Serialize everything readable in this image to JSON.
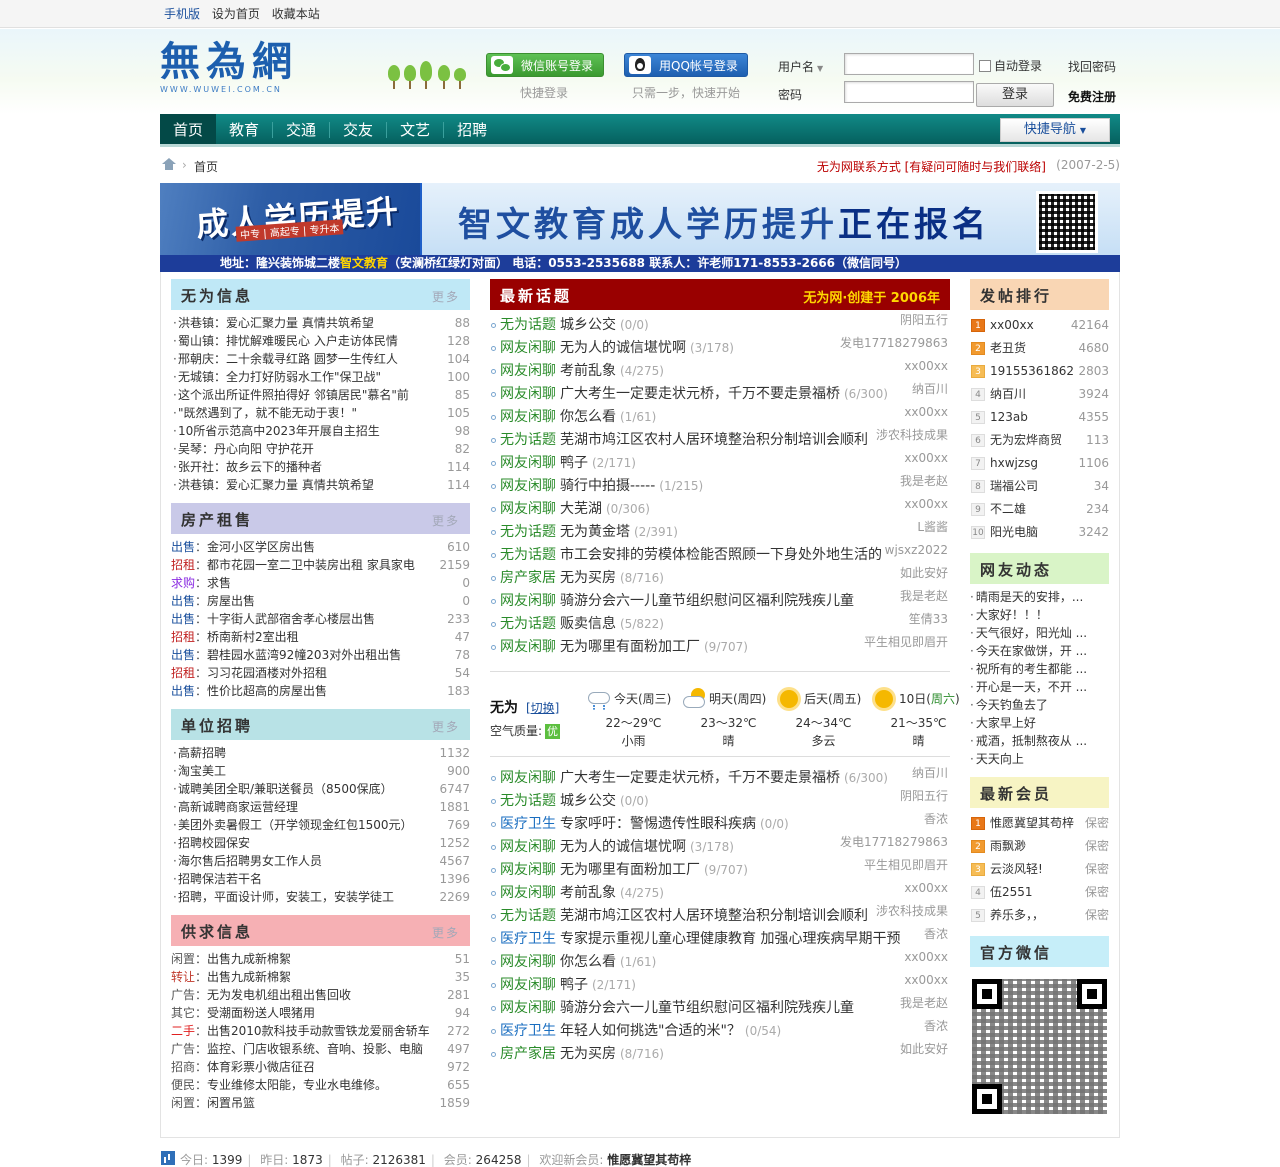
{
  "topbar": {
    "mobile": "手机版",
    "homepage": "设为首页",
    "favorite": "收藏本站"
  },
  "logo": {
    "title": "無為網",
    "domain": "WWW.WUWEI.COM.CN"
  },
  "login": {
    "wechat_label": "微信账号登录",
    "wechat_hint": "快捷登录",
    "qq_label": "用QQ帐号登录",
    "qq_hint": "只需一步，快速开始",
    "username_label": "用户名",
    "password_label": "密码",
    "auto_login": "自动登录",
    "find_password": "找回密码",
    "login_button": "登录",
    "register": "免费注册"
  },
  "nav": {
    "items": [
      "首页",
      "教育",
      "交通",
      "交友",
      "文艺",
      "招聘"
    ],
    "quick": "快捷导航"
  },
  "breadcrumb": {
    "home": "首页",
    "contact": "无为网联系方式 [有疑问可随时与我们联络]",
    "date": "(2007-2-5)"
  },
  "banner": {
    "left_text": "成人学历提升",
    "left_sub": "中专 | 高起专 | 专升本",
    "headline_a": "智文教育成人学历提升",
    "headline_b": "正在报名",
    "addr_a": "地址：隆兴装饰城二楼",
    "addr_b": "智文教育",
    "addr_c": "（安澜桥红绿灯对面）   电话：0553-2535688   联系人：许老师171-8553-2666（微信同号）"
  },
  "info": {
    "title": "无为信息",
    "more": "更多",
    "rows": [
      {
        "t": "洪巷镇：爱心汇聚力量 真情共筑希望",
        "n": "88"
      },
      {
        "t": "蜀山镇：排忧解难暖民心 入户走访体民情",
        "n": "128"
      },
      {
        "t": "邢朝庆：二十余载寻红路 圆梦一生传红人",
        "n": "104"
      },
      {
        "t": "无城镇：全力打好防弱水工作\"保卫战\"",
        "n": "100"
      },
      {
        "t": "这个派出所证件照拍得好 邻镇居民\"慕名\"前",
        "n": "85"
      },
      {
        "t": "\"既然遇到了，就不能无动于衷！\"",
        "n": "105"
      },
      {
        "t": "10所省示范高中2023年开展自主招生",
        "n": "98"
      },
      {
        "t": "吴琴：丹心向阳 守护花开",
        "n": "82"
      },
      {
        "t": "张开社：故乡云下的播种者",
        "n": "114"
      },
      {
        "t": "洪巷镇：爱心汇聚力量 真情共筑希望",
        "n": "114"
      }
    ]
  },
  "rental": {
    "title": "房产租售",
    "more": "更多",
    "rows": [
      {
        "c": "出售",
        "k": "blue",
        "t": "金河小区学区房出售",
        "n": "610"
      },
      {
        "c": "招租",
        "k": "red",
        "t": "都市花园一室二卫中装房出租 家具家电",
        "n": "2159"
      },
      {
        "c": "求购",
        "k": "purple",
        "t": "求售",
        "n": "0"
      },
      {
        "c": "出售",
        "k": "blue",
        "t": "房屋出售",
        "n": "0"
      },
      {
        "c": "出售",
        "k": "blue",
        "t": "十字街人武部宿舍孝心楼层出售",
        "n": "233"
      },
      {
        "c": "招租",
        "k": "red",
        "t": "桥南新村2室出租",
        "n": "47"
      },
      {
        "c": "出售",
        "k": "blue",
        "t": "碧桂园水蓝湾92幢203对外出租出售",
        "n": "78"
      },
      {
        "c": "招租",
        "k": "red",
        "t": "习习花园酒楼对外招租",
        "n": "54"
      },
      {
        "c": "出售",
        "k": "blue",
        "t": "性价比超高的房屋出售",
        "n": "183"
      }
    ]
  },
  "jobs": {
    "title": "单位招聘",
    "more": "更多",
    "rows": [
      {
        "t": "高薪招聘",
        "n": "1132"
      },
      {
        "t": "淘宝美工",
        "n": "900"
      },
      {
        "t": "诚聘美团全职/兼职送餐员（8500保底）",
        "n": "6747"
      },
      {
        "t": "高新诚聘商家运营经理",
        "n": "1881"
      },
      {
        "t": "美团外卖暑假工（开学领现金红包1500元）",
        "n": "769"
      },
      {
        "t": "招聘校园保安",
        "n": "1252"
      },
      {
        "t": "海尔售后招聘男女工作人员",
        "n": "4567"
      },
      {
        "t": "招聘保洁若干名",
        "n": "1396"
      },
      {
        "t": "招聘，平面设计师，安装工，安装学徒工",
        "n": "2269"
      }
    ]
  },
  "supply": {
    "title": "供求信息",
    "more": "更多",
    "rows": [
      {
        "c": "闲置",
        "k": "gray",
        "t": "出售九成新棉絮",
        "n": "51"
      },
      {
        "c": "转让",
        "k": "orange",
        "t": "出售九成新棉絮",
        "n": "35"
      },
      {
        "c": "广告",
        "k": "gray",
        "t": "无为发电机组出租出售回收",
        "n": "281"
      },
      {
        "c": "其它",
        "k": "gray",
        "t": "受潮面粉送人喂猪用",
        "n": "94"
      },
      {
        "c": "二手",
        "k": "redc",
        "t": "出售2010款科技手动款雪铁龙爱丽舍轿车",
        "n": "272"
      },
      {
        "c": "广告",
        "k": "gray",
        "t": "监控、门店收银系统、音响、投影、电脑",
        "n": "497"
      },
      {
        "c": "招商",
        "k": "gray",
        "t": "体育彩票小微店征召",
        "n": "972"
      },
      {
        "c": "便民",
        "k": "gray",
        "t": "专业维修太阳能，专业水电维修。",
        "n": "655"
      },
      {
        "c": "闲置",
        "k": "gray",
        "t": "闲置吊篮",
        "n": "1859"
      }
    ]
  },
  "latest": {
    "title": "最新话题",
    "right": "无为网·创建于 2006年",
    "rows": [
      {
        "c": "无为话题",
        "k": "g",
        "t": "城乡公交",
        "n": "(0/0)",
        "a": "阴阳五行"
      },
      {
        "c": "网友闲聊",
        "k": "g",
        "t": "无为人的诚信堪忧啊",
        "n": "(3/178)",
        "a": "发电17718279863"
      },
      {
        "c": "网友闲聊",
        "k": "g",
        "t": "考前乱象",
        "n": "(4/275)",
        "a": "xx00xx"
      },
      {
        "c": "网友闲聊",
        "k": "g",
        "t": "广大考生一定要走状元桥，千万不要走景福桥",
        "n": "(6/300)",
        "a": "纳百川"
      },
      {
        "c": "网友闲聊",
        "k": "g",
        "t": "你怎么看",
        "n": "(1/61)",
        "a": "xx00xx"
      },
      {
        "c": "无为话题",
        "k": "g",
        "t": "芜湖市鸠江区农村人居环境整治积分制培训会顺利",
        "n": "",
        "a": "涉农科技成果"
      },
      {
        "c": "网友闲聊",
        "k": "g",
        "t": "鸭子",
        "n": "(2/171)",
        "a": "xx00xx"
      },
      {
        "c": "网友闲聊",
        "k": "g",
        "t": "骑行中拍摄-----",
        "n": "(1/215)",
        "a": "我是老赵"
      },
      {
        "c": "网友闲聊",
        "k": "g",
        "t": "大芜湖",
        "n": "(0/306)",
        "a": "xx00xx"
      },
      {
        "c": "无为话题",
        "k": "g",
        "t": "无为黄金塔",
        "n": "(2/391)",
        "a": "L酱酱"
      },
      {
        "c": "无为话题",
        "k": "g",
        "t": "市工会安排的劳模体检能否照顾一下身处外地生活的",
        "n": "",
        "a": "wjsxz2022"
      },
      {
        "c": "房产家居",
        "k": "g",
        "t": "无为买房",
        "n": "(8/716)",
        "a": "如此安好"
      },
      {
        "c": "网友闲聊",
        "k": "g",
        "t": "骑游分会六一儿童节组织慰问区福利院残疾儿童",
        "n": "",
        "a": "我是老赵"
      },
      {
        "c": "无为话题",
        "k": "g",
        "t": "贩卖信息",
        "n": "(5/822)",
        "a": "笙倩33"
      },
      {
        "c": "网友闲聊",
        "k": "g",
        "t": "无为哪里有面粉加工厂",
        "n": "(9/707)",
        "a": "平生相见即眉开"
      }
    ]
  },
  "weather": {
    "city": "无为",
    "switch": "[切换]",
    "aq_label": "空气质量:",
    "aq_value": "优",
    "days": [
      {
        "name": "今天(周三)",
        "temp": "22～29℃",
        "desc": "小雨",
        "icon": "rain-icon"
      },
      {
        "name": "明天(周四)",
        "temp": "23～32℃",
        "desc": "晴",
        "icon": "sun-cloud-icon"
      },
      {
        "name": "后天(周五)",
        "temp": "24～34℃",
        "desc": "多云",
        "icon": "sun-icon"
      },
      {
        "name": "10日(",
        "name_g": "周六",
        "name_end": ")",
        "temp": "21～35℃",
        "desc": "晴",
        "icon": "sun-icon"
      }
    ]
  },
  "topics2": {
    "rows": [
      {
        "c": "网友闲聊",
        "k": "g",
        "t": "广大考生一定要走状元桥，千万不要走景福桥",
        "n": "(6/300)",
        "a": "纳百川"
      },
      {
        "c": "无为话题",
        "k": "g",
        "t": "城乡公交",
        "n": "(0/0)",
        "a": "阴阳五行"
      },
      {
        "c": "医疗卫生",
        "k": "med",
        "t": "专家呼吁：警惕遗传性眼科疾病",
        "n": "(0/0)",
        "a": "香浓"
      },
      {
        "c": "网友闲聊",
        "k": "g",
        "t": "无为人的诚信堪忧啊",
        "n": "(3/178)",
        "a": "发电17718279863"
      },
      {
        "c": "网友闲聊",
        "k": "g",
        "t": "无为哪里有面粉加工厂",
        "n": "(9/707)",
        "a": "平生相见即眉开"
      },
      {
        "c": "网友闲聊",
        "k": "g",
        "t": "考前乱象",
        "n": "(4/275)",
        "a": "xx00xx"
      },
      {
        "c": "无为话题",
        "k": "g",
        "t": "芜湖市鸠江区农村人居环境整治积分制培训会顺利",
        "n": "",
        "a": "涉农科技成果"
      },
      {
        "c": "医疗卫生",
        "k": "med",
        "t": "专家提示重视儿童心理健康教育 加强心理疾病早期干预",
        "n": "",
        "a": "香浓"
      },
      {
        "c": "网友闲聊",
        "k": "g",
        "t": "你怎么看",
        "n": "(1/61)",
        "a": "xx00xx"
      },
      {
        "c": "网友闲聊",
        "k": "g",
        "t": "鸭子",
        "n": "(2/171)",
        "a": "xx00xx"
      },
      {
        "c": "网友闲聊",
        "k": "g",
        "t": "骑游分会六一儿童节组织慰问区福利院残疾儿童",
        "n": "",
        "a": "我是老赵"
      },
      {
        "c": "医疗卫生",
        "k": "med",
        "t": "年轻人如何挑选\"合适的米\"？",
        "n": "(0/54)",
        "a": "香浓"
      },
      {
        "c": "房产家居",
        "k": "g",
        "t": "无为买房",
        "n": "(8/716)",
        "a": "如此安好"
      }
    ]
  },
  "ranking": {
    "title": "发帖排行",
    "rows": [
      {
        "r": "1",
        "name": "xx00xx",
        "v": "42164"
      },
      {
        "r": "2",
        "name": "老丑货",
        "v": "4680"
      },
      {
        "r": "3",
        "name": "19155361862",
        "v": "2803"
      },
      {
        "r": "4",
        "name": "纳百川",
        "v": "3924"
      },
      {
        "r": "5",
        "name": "123ab",
        "v": "4355"
      },
      {
        "r": "6",
        "name": "无为宏烨商贸",
        "v": "113"
      },
      {
        "r": "7",
        "name": "hxwjzsg",
        "v": "1106"
      },
      {
        "r": "8",
        "name": "瑞福公司",
        "v": "34"
      },
      {
        "r": "9",
        "name": "不二雄",
        "v": "234"
      },
      {
        "r": "10",
        "name": "阳光电脑",
        "v": "3242"
      }
    ]
  },
  "feed": {
    "title": "网友动态",
    "rows": [
      "晴雨是天的安排，...",
      "大家好！！！",
      "天气很好，阳光灿 ...",
      "今天在家做饼，开 ...",
      "祝所有的考生都能 ...",
      "开心是一天，不开 ...",
      "今天钓鱼去了",
      "大家早上好",
      "戒酒，抵制熬夜从 ...",
      "天天向上"
    ]
  },
  "members": {
    "title": "最新会员",
    "rows": [
      {
        "r": "1",
        "name": "惟愿冀望其苟梓",
        "v": "保密"
      },
      {
        "r": "2",
        "name": "雨飘渺",
        "v": "保密"
      },
      {
        "r": "3",
        "name": "云淡风轻!",
        "v": "保密"
      },
      {
        "r": "4",
        "name": "伍2551",
        "v": "保密"
      },
      {
        "r": "5",
        "name": "养乐多，，",
        "v": "保密"
      }
    ]
  },
  "wechat": {
    "title": "官方微信"
  },
  "footer": {
    "today_label": "今日:",
    "today": "1399",
    "yesterday_label": "昨日:",
    "yesterday": "1873",
    "posts_label": "帖子:",
    "posts": "2126381",
    "members_label": "会员:",
    "members": "264258",
    "welcome_label": "欢迎新会员:",
    "newest": "惟愿冀望其苟梓"
  }
}
